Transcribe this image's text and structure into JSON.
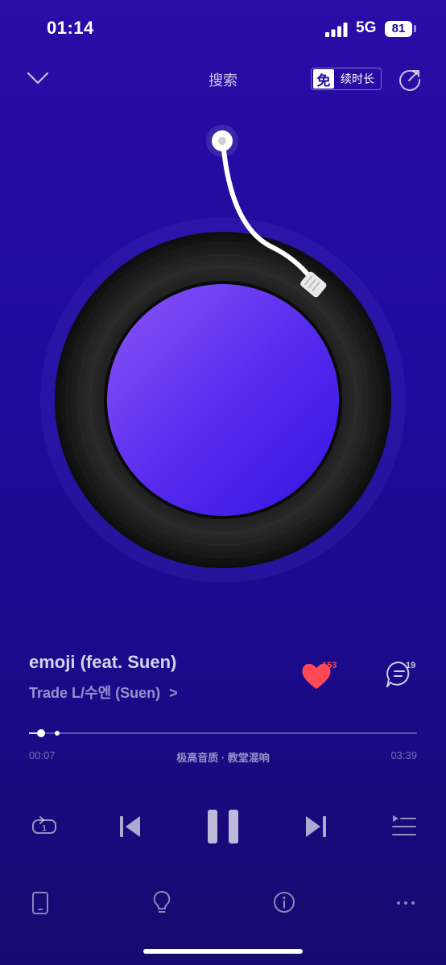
{
  "status_bar": {
    "time": "01:14",
    "network": "5G",
    "battery": "81"
  },
  "header": {
    "center_tab": "搜索",
    "free_badge_icon": "免",
    "free_badge_label": "续时长"
  },
  "song": {
    "title": "emoji (feat. Suen)",
    "artist": "Trade L/수엔 (Suen)",
    "artist_chevron": ">",
    "like_count": "153",
    "comment_count": "19"
  },
  "progress": {
    "current": "00:07",
    "total": "03:39",
    "quality_label": "极高音质 · 教堂混响",
    "fraction": 0.032
  },
  "icons": {
    "collapse": "chevron-down-icon",
    "share": "share-icon",
    "like": "heart-icon",
    "comment": "comment-icon",
    "repeat": "repeat-one-icon",
    "prev": "previous-icon",
    "pause": "pause-icon",
    "next": "next-icon",
    "playlist": "playlist-icon",
    "device": "device-icon",
    "bulb": "lightbulb-icon",
    "info": "info-icon",
    "more": "more-icon"
  },
  "colors": {
    "background": "#2a0ca6",
    "like": "#ff4a55",
    "cover_start": "#7a4cf2",
    "cover_end": "#3d17e6"
  }
}
